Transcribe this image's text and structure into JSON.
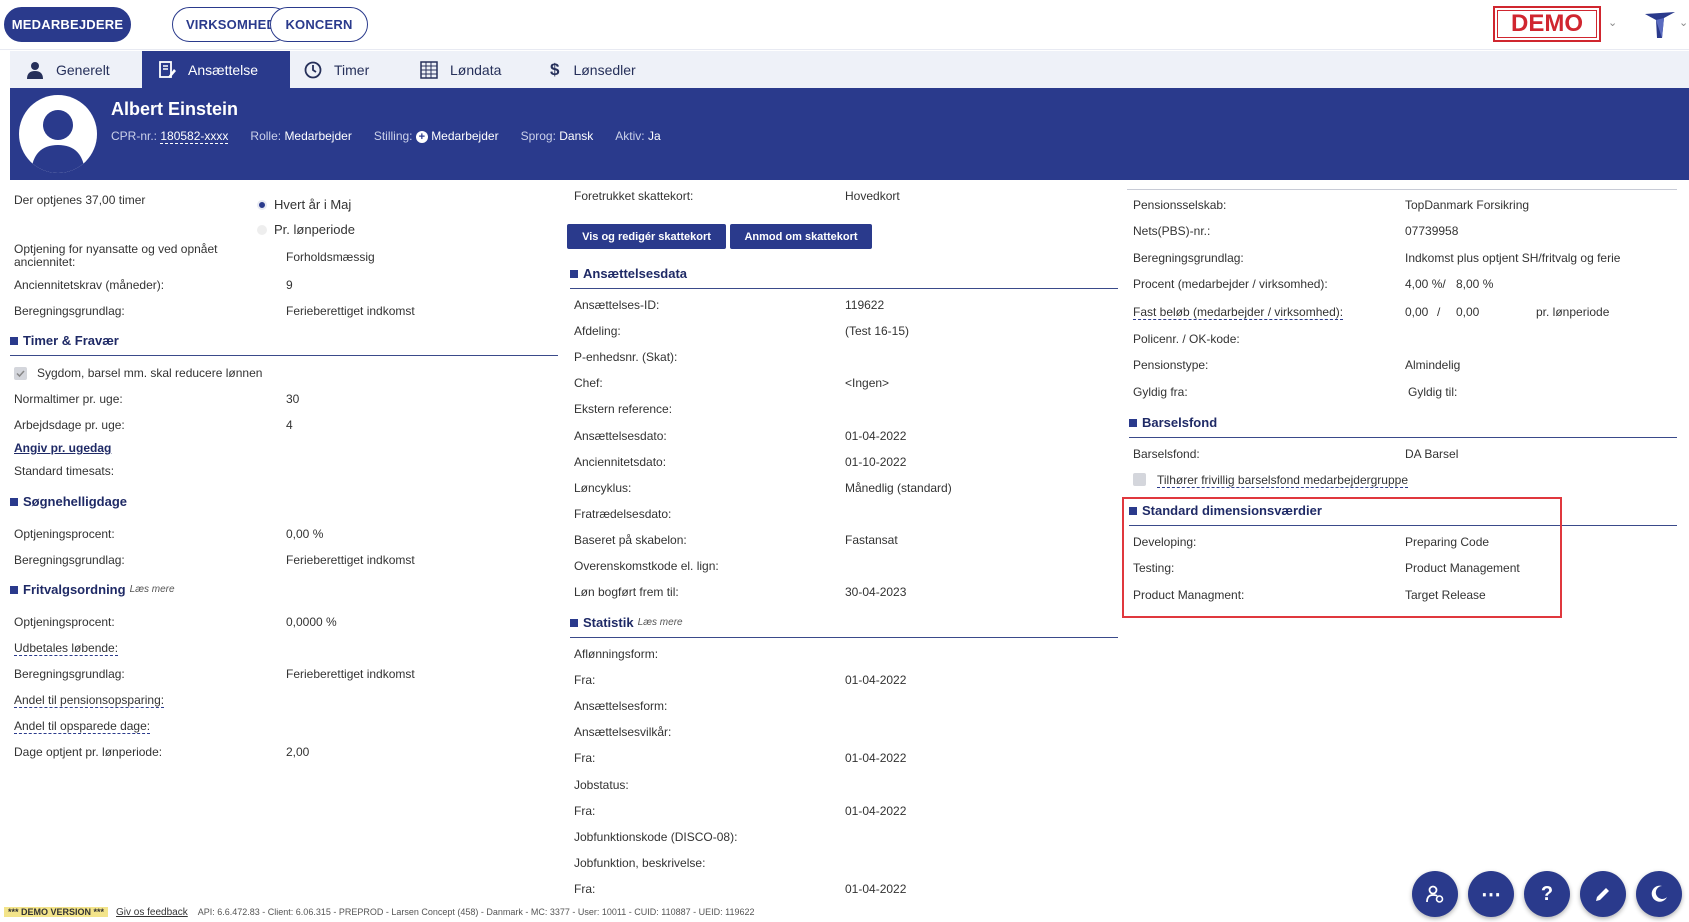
{
  "topbar": {
    "btn_medarbejdere": "MEDARBEJDERE",
    "btn_virksomhed": "VIRKSOMHED",
    "btn_koncern": "KONCERN",
    "demo": "DEMO"
  },
  "tabs": [
    "Generelt",
    "Ansættelse",
    "Timer",
    "Løndata",
    "Lønsedler"
  ],
  "profile": {
    "name": "Albert Einstein",
    "cpr_label": "CPR-nr.:",
    "cpr": "180582-xxxx",
    "role_label": "Rolle:",
    "role": "Medarbejder",
    "position_label": "Stilling:",
    "position": "Medarbejder",
    "lang_label": "Sprog:",
    "lang": "Dansk",
    "active_label": "Aktiv:",
    "active": "Ja"
  },
  "left": {
    "accrual_label": "Der optjenes 37,00 timer",
    "radio1": "Hvert år i Maj",
    "radio2": "Pr. lønperiode",
    "newhire_label": "Optjening for nyansatte og ved opnået anciennitet:",
    "newhire_value": "Forholdsmæssig",
    "seniority_label": "Anciennitetskrav (måneder):",
    "seniority_value": "9",
    "basis_label": "Beregningsgrundlag:",
    "basis_value": "Ferieberettiget indkomst",
    "timer_title": "Timer & Fravær",
    "sick_label": "Sygdom, barsel mm. skal reducere lønnen",
    "normal_label": "Normaltimer pr. uge:",
    "normal_value": "30",
    "workdays_label": "Arbejdsdage pr. uge:",
    "workdays_value": "4",
    "perday_link": "Angiv pr. ugedag",
    "rate_label": "Standard timesats:",
    "sh_title": "Søgnehelligdage",
    "sh_pct_label": "Optjeningsprocent:",
    "sh_pct_value": "0,00 %",
    "sh_basis_label": "Beregningsgrundlag:",
    "sh_basis_value": "Ferieberettiget indkomst",
    "fv_title": "Fritvalgsordning",
    "fv_more": "Læs mere",
    "fv_pct_label": "Optjeningsprocent:",
    "fv_pct_value": "0,0000 %",
    "fv_paid_label": "Udbetales løbende:",
    "fv_basis_label": "Beregningsgrundlag:",
    "fv_basis_value": "Ferieberettiget indkomst",
    "fv_pension_label": "Andel til pensionsopsparing:",
    "fv_saved_label": "Andel til opsparede dage:",
    "fv_days_label": "Dage optjent pr. lønperiode:",
    "fv_days_value": "2,00"
  },
  "middle": {
    "taxcard_label": "Foretrukket skattekort:",
    "taxcard_value": "Hovedkort",
    "btn_view": "Vis og redigér skattekort",
    "btn_request": "Anmod om skattekort",
    "emp_title": "Ansættelsesdata",
    "emp_rows": [
      {
        "label": "Ansættelses-ID:",
        "value": "119622"
      },
      {
        "label": "Afdeling:",
        "value": "(Test 16-15)"
      },
      {
        "label": "P-enhedsnr. (Skat):",
        "value": ""
      },
      {
        "label": "Chef:",
        "value": "<Ingen>"
      },
      {
        "label": "Ekstern reference:",
        "value": ""
      },
      {
        "label": "Ansættelsesdato:",
        "value": "01-04-2022"
      },
      {
        "label": "Anciennitetsdato:",
        "value": "01-10-2022"
      },
      {
        "label": "Løncyklus:",
        "value": "Månedlig (standard)"
      },
      {
        "label": "Fratrædelsesdato:",
        "value": ""
      },
      {
        "label": "Baseret på skabelon:",
        "value": "Fastansat"
      },
      {
        "label": "Overenskomstkode el. lign:",
        "value": ""
      },
      {
        "label": "Løn bogført frem til:",
        "value": "30-04-2023"
      }
    ],
    "stat_title": "Statistik",
    "stat_more": "Læs mere",
    "stat_rows": [
      {
        "label": "Aflønningsform:",
        "value": ""
      },
      {
        "label": "Fra:",
        "value": "01-04-2022"
      },
      {
        "label": "Ansættelsesform:",
        "value": ""
      },
      {
        "label": "Ansættelsesvilkår:",
        "value": ""
      },
      {
        "label": "Fra:",
        "value": "01-04-2022"
      },
      {
        "label": "Jobstatus:",
        "value": ""
      },
      {
        "label": "Fra:",
        "value": "01-04-2022"
      },
      {
        "label": "Jobfunktionskode (DISCO-08):",
        "value": ""
      },
      {
        "label": "Jobfunktion, beskrivelse:",
        "value": ""
      },
      {
        "label": "Fra:",
        "value": "01-04-2022"
      }
    ]
  },
  "right": {
    "pension_company_label": "Pensionsselskab:",
    "pension_company": "TopDanmark Forsikring",
    "nets_label": "Nets(PBS)-nr.:",
    "nets": "07739958",
    "basis_label": "Beregningsgrundlag:",
    "basis": "Indkomst plus optjent SH/fritvalg og ferie",
    "pct_label": "Procent (medarbejder / virksomhed):",
    "pct_emp": "4,00 %/",
    "pct_comp": "8,00 %",
    "fixed_label": "Fast beløb (medarbejder / virksomhed):",
    "fixed_emp": "0,00",
    "fixed_sep": "/",
    "fixed_comp": "0,00",
    "fixed_period": "pr. lønperiode",
    "policy_label": "Policenr. / OK-kode:",
    "ptype_label": "Pensionstype:",
    "ptype": "Almindelig",
    "valid_from_label": "Gyldig fra:",
    "valid_to_label": "Gyldig til:",
    "bf_title": "Barselsfond",
    "bf_label": "Barselsfond:",
    "bf_value": "DA Barsel",
    "bf_check": "Tilhører frivillig barselsfond medarbejdergruppe",
    "dim_title": "Standard dimensionsværdier",
    "dim_rows": [
      {
        "label": "Developing:",
        "value": "Preparing Code"
      },
      {
        "label": "Testing:",
        "value": "Product Management"
      },
      {
        "label": "Product Managment:",
        "value": "Target Release"
      }
    ]
  },
  "footer": {
    "demo": "*** DEMO VERSION ***",
    "feedback": "Giv os feedback",
    "info": "API: 6.6.472.83 - Client: 6.06.315 - PREPROD - Larsen Concept (458) - Danmark - MC: 3377 - User: 10011 - CUID: 110887 - UEID: 119622"
  },
  "fab_icons": [
    "person-settings-icon",
    "more-icon",
    "help-icon",
    "edit-icon",
    "dark-mode-icon"
  ],
  "colors": {
    "primary": "#2a3a8c",
    "demo_red": "#d0262f",
    "highlight": "#e0383e"
  }
}
